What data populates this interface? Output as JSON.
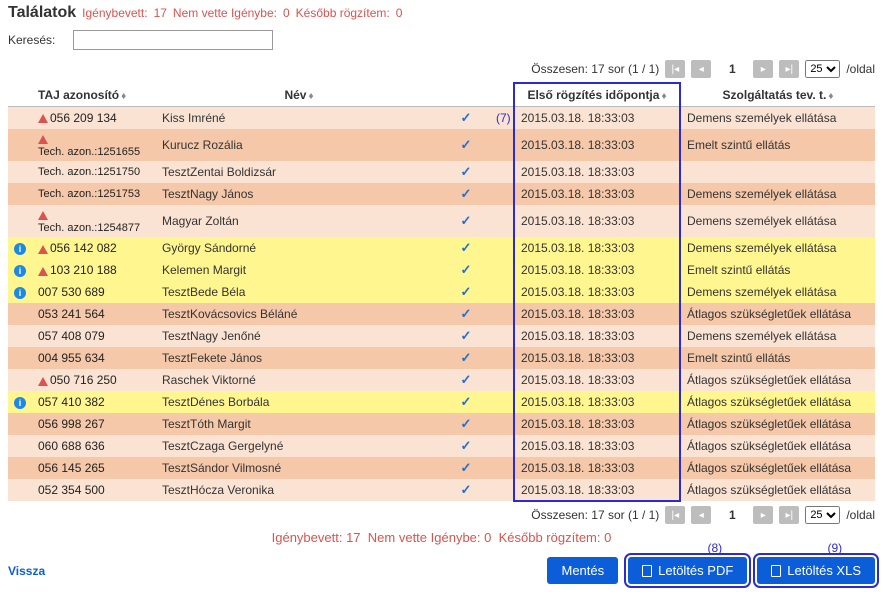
{
  "title": "Találatok",
  "stats": {
    "used_label": "Igénybevett:",
    "used_value": "17",
    "notused_label": "Nem vette Igénybe:",
    "notused_value": "0",
    "later_label": "Később rögzítem:",
    "later_value": "0"
  },
  "search": {
    "label": "Keresés:",
    "value": "",
    "placeholder": ""
  },
  "pager": {
    "summary": "Összesen: 17 sor (1 / 1)",
    "page": "1",
    "perpage_selected": "25",
    "perpage_suffix": "/oldal"
  },
  "columns": {
    "taj": "TAJ azonosító",
    "name": "Név",
    "check": "-",
    "time": "Első rögzítés időpontja",
    "service": "Szolgáltatás tev. t."
  },
  "annotations": {
    "col7": "(7)",
    "btn8": "(8)",
    "btn9": "(9)"
  },
  "rows": [
    {
      "info": false,
      "warn": true,
      "hl": false,
      "taj": "056 209 134",
      "tech": "",
      "name": "Kiss Imréné",
      "time": "2015.03.18. 18:33:03",
      "service": "Demens személyek ellátása"
    },
    {
      "info": false,
      "warn": true,
      "hl": false,
      "taj": "",
      "tech": "Tech. azon.:1251655",
      "name": "Kurucz Rozália",
      "time": "2015.03.18. 18:33:03",
      "service": "Emelt szintű ellátás"
    },
    {
      "info": false,
      "warn": false,
      "hl": false,
      "taj": "",
      "tech": "Tech. azon.:1251750",
      "name": "TesztZentai Boldizsár",
      "time": "2015.03.18. 18:33:03",
      "service": ""
    },
    {
      "info": false,
      "warn": false,
      "hl": false,
      "taj": "",
      "tech": "Tech. azon.:1251753",
      "name": "TesztNagy János",
      "time": "2015.03.18. 18:33:03",
      "service": "Demens személyek ellátása"
    },
    {
      "info": false,
      "warn": true,
      "hl": false,
      "taj": "",
      "tech": "Tech. azon.:1254877",
      "name": "Magyar Zoltán",
      "time": "2015.03.18. 18:33:03",
      "service": "Demens személyek ellátása"
    },
    {
      "info": true,
      "warn": true,
      "hl": true,
      "taj": "056 142 082",
      "tech": "",
      "name": "György Sándorné",
      "time": "2015.03.18. 18:33:03",
      "service": "Demens személyek ellátása"
    },
    {
      "info": true,
      "warn": true,
      "hl": true,
      "taj": "103 210 188",
      "tech": "",
      "name": "Kelemen Margit",
      "time": "2015.03.18. 18:33:03",
      "service": "Emelt szintű ellátás"
    },
    {
      "info": true,
      "warn": false,
      "hl": true,
      "taj": "007 530 689",
      "tech": "",
      "name": "TesztBede Béla",
      "time": "2015.03.18. 18:33:03",
      "service": "Demens személyek ellátása"
    },
    {
      "info": false,
      "warn": false,
      "hl": false,
      "taj": "053 241 564",
      "tech": "",
      "name": "TesztKovácsovics Béláné",
      "time": "2015.03.18. 18:33:03",
      "service": "Átlagos szükségletűek ellátása"
    },
    {
      "info": false,
      "warn": false,
      "hl": false,
      "taj": "057 408 079",
      "tech": "",
      "name": "TesztNagy Jenőné",
      "time": "2015.03.18. 18:33:03",
      "service": "Demens személyek ellátása"
    },
    {
      "info": false,
      "warn": false,
      "hl": false,
      "taj": "004 955 634",
      "tech": "",
      "name": "TesztFekete János",
      "time": "2015.03.18. 18:33:03",
      "service": "Emelt szintű ellátás"
    },
    {
      "info": false,
      "warn": true,
      "hl": false,
      "taj": "050 716 250",
      "tech": "",
      "name": "Raschek Viktorné",
      "time": "2015.03.18. 18:33:03",
      "service": "Átlagos szükségletűek ellátása"
    },
    {
      "info": true,
      "warn": false,
      "hl": true,
      "taj": "057 410 382",
      "tech": "",
      "name": "TesztDénes Borbála",
      "time": "2015.03.18. 18:33:03",
      "service": "Átlagos szükségletűek ellátása"
    },
    {
      "info": false,
      "warn": false,
      "hl": false,
      "taj": "056 998 267",
      "tech": "",
      "name": "TesztTóth Margit",
      "time": "2015.03.18. 18:33:03",
      "service": "Átlagos szükségletűek ellátása"
    },
    {
      "info": false,
      "warn": false,
      "hl": false,
      "taj": "060 688 636",
      "tech": "",
      "name": "TesztCzaga Gergelyné",
      "time": "2015.03.18. 18:33:03",
      "service": "Átlagos szükségletűek ellátása"
    },
    {
      "info": false,
      "warn": false,
      "hl": false,
      "taj": "056 145 265",
      "tech": "",
      "name": "TesztSándor Vilmosné",
      "time": "2015.03.18. 18:33:03",
      "service": "Átlagos szükségletűek ellátása"
    },
    {
      "info": false,
      "warn": false,
      "hl": false,
      "taj": "052 354 500",
      "tech": "",
      "name": "TesztHócza Veronika",
      "time": "2015.03.18. 18:33:03",
      "service": "Átlagos szükségletűek ellátása"
    }
  ],
  "buttons": {
    "back": "Vissza",
    "save": "Mentés",
    "pdf": "Letöltés PDF",
    "xls": "Letöltés XLS"
  }
}
